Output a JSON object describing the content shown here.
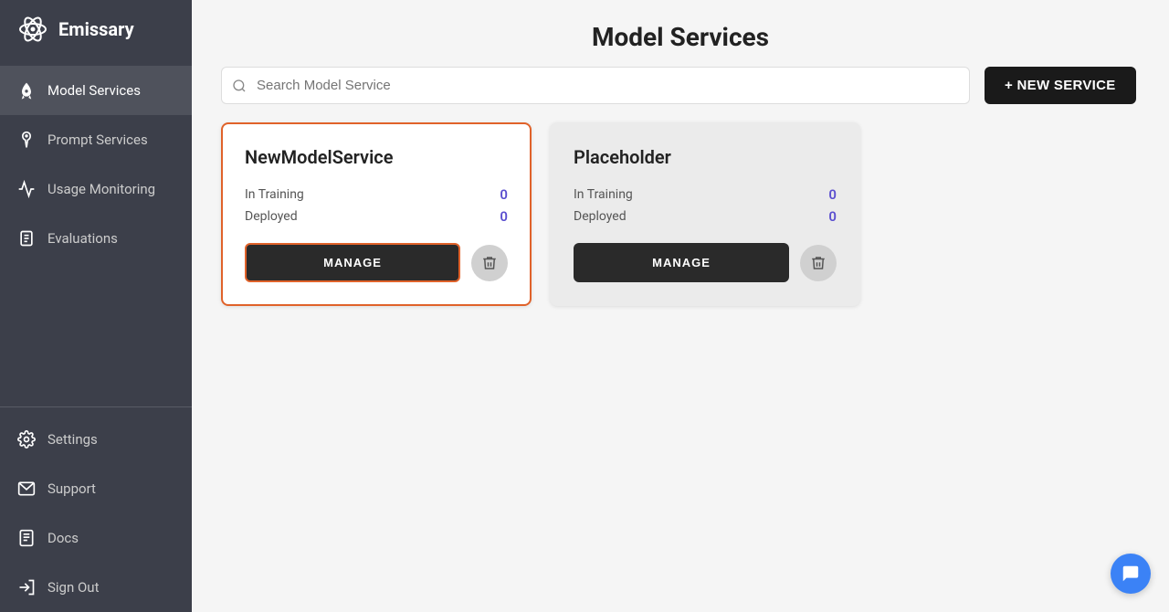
{
  "app": {
    "name": "Emissary"
  },
  "sidebar": {
    "items": [
      {
        "id": "model-services",
        "label": "Model Services",
        "active": true
      },
      {
        "id": "prompt-services",
        "label": "Prompt Services",
        "active": false
      },
      {
        "id": "usage-monitoring",
        "label": "Usage Monitoring",
        "active": false
      },
      {
        "id": "evaluations",
        "label": "Evaluations",
        "active": false
      }
    ],
    "bottom_items": [
      {
        "id": "settings",
        "label": "Settings"
      },
      {
        "id": "support",
        "label": "Support"
      },
      {
        "id": "docs",
        "label": "Docs"
      },
      {
        "id": "sign-out",
        "label": "Sign Out"
      }
    ]
  },
  "page": {
    "title": "Model Services"
  },
  "search": {
    "placeholder": "Search Model Service"
  },
  "toolbar": {
    "new_service_label": "+ NEW SERVICE"
  },
  "cards": [
    {
      "id": "new-model-service",
      "title": "NewModelService",
      "in_training": "0",
      "deployed": "0",
      "selected": true,
      "manage_label": "MANAGE",
      "manage_highlighted": true,
      "placeholder": false
    },
    {
      "id": "placeholder",
      "title": "Placeholder",
      "in_training": "0",
      "deployed": "0",
      "selected": false,
      "manage_label": "MANAGE",
      "manage_highlighted": false,
      "placeholder": true
    }
  ],
  "labels": {
    "in_training": "In Training",
    "deployed": "Deployed"
  }
}
